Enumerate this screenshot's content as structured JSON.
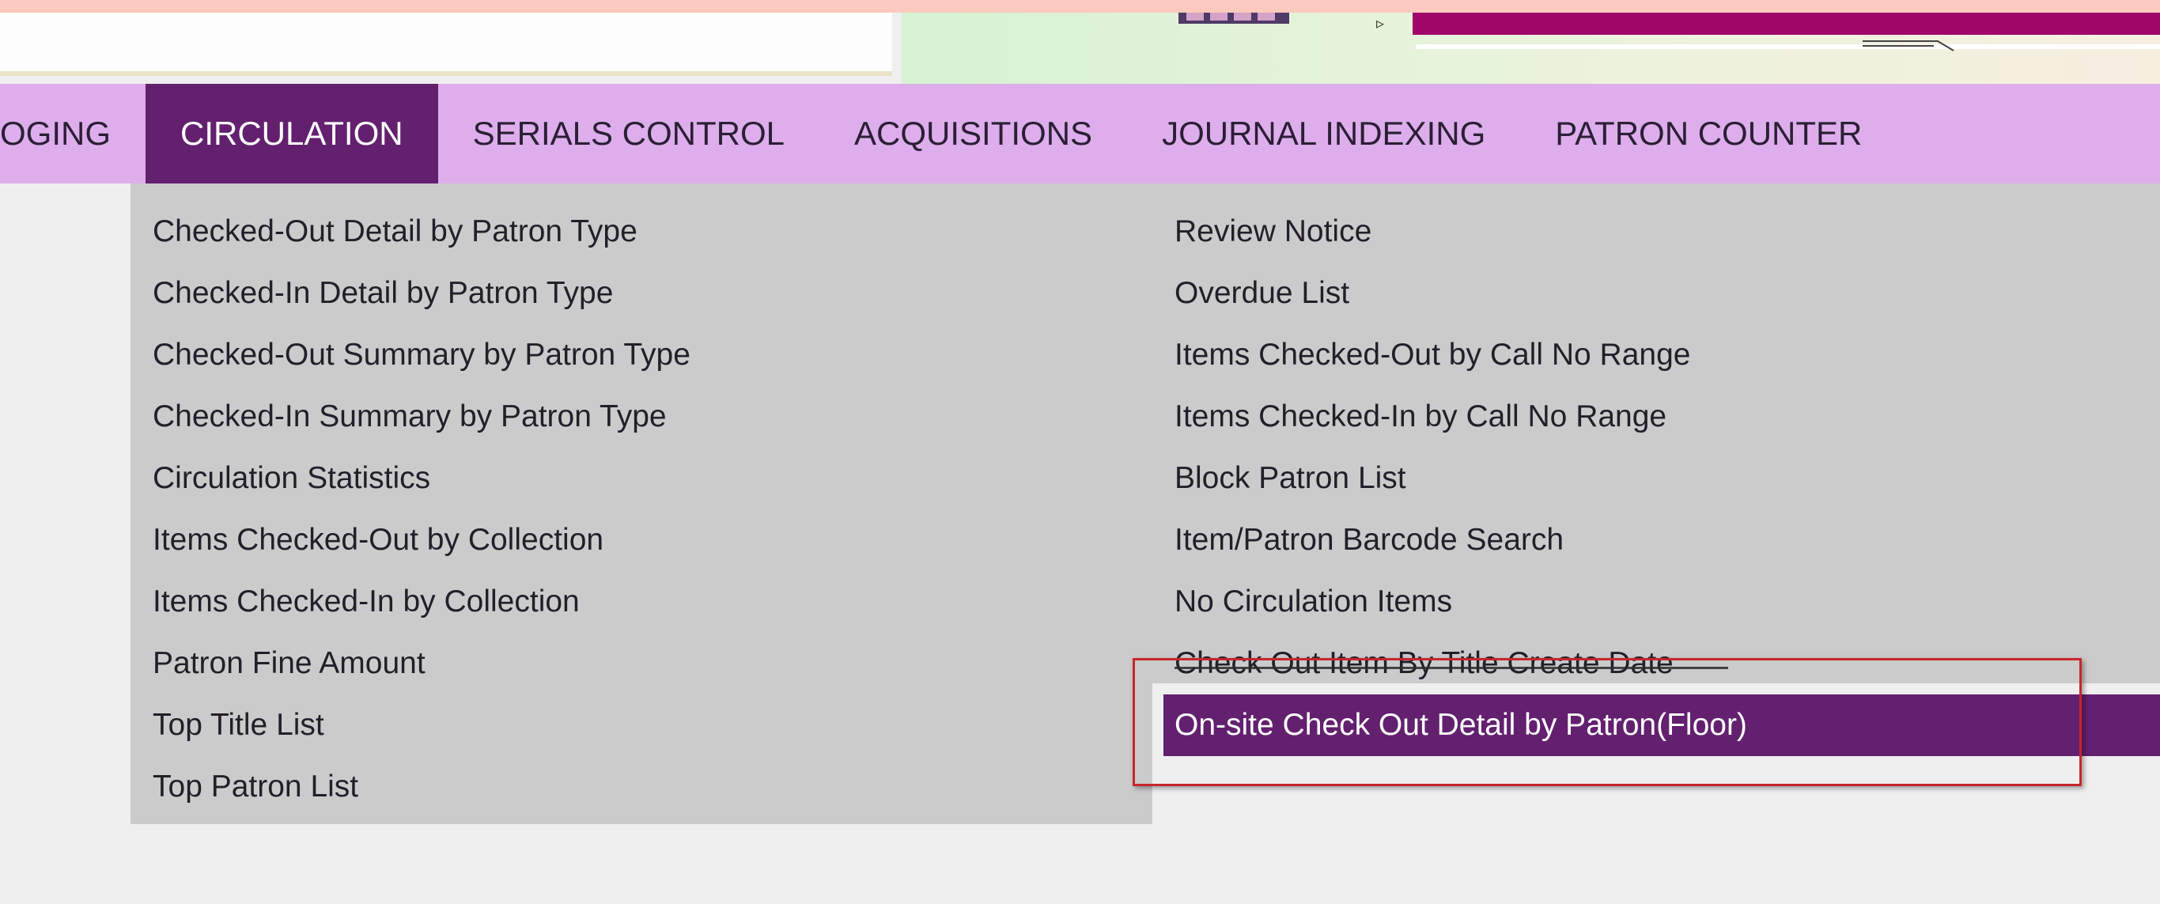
{
  "nav": {
    "tabs": [
      {
        "label": "OGING"
      },
      {
        "label": "CIRCULATION"
      },
      {
        "label": "SERIALS CONTROL"
      },
      {
        "label": "ACQUISITIONS"
      },
      {
        "label": "JOURNAL INDEXING"
      },
      {
        "label": "PATRON COUNTER"
      }
    ],
    "active_tab": "CIRCULATION"
  },
  "dropdown": {
    "left_column": [
      "Checked-Out Detail by Patron Type",
      "Checked-In Detail by Patron Type",
      "Checked-Out Summary by Patron Type",
      "Checked-In Summary by Patron Type",
      "Circulation Statistics",
      "Items Checked-Out by Collection",
      "Items Checked-In by Collection",
      "Patron Fine Amount",
      "Top Title List",
      "Top Patron List"
    ],
    "right_column": [
      "Review Notice",
      "Overdue List",
      "Items Checked-Out by Call No Range",
      "Items Checked-In by Call No Range",
      "Block Patron List",
      "Item/Patron Barcode Search",
      "No Circulation Items",
      "Check Out Item By Title Create Date",
      "On-site Check Out Detail by Patron(Floor)"
    ],
    "highlighted_item": "On-site Check Out Detail by Patron(Floor)"
  },
  "icons": {
    "banner_play": "play-triangle-icon"
  },
  "colors": {
    "nav_bg": "#deaeec",
    "active_tab_bg": "#63206f",
    "dropdown_bg": "#cbcbcb",
    "highlight_bg": "#63206f",
    "annotation_border": "#c7262c",
    "banner_band": "#a1066b"
  }
}
